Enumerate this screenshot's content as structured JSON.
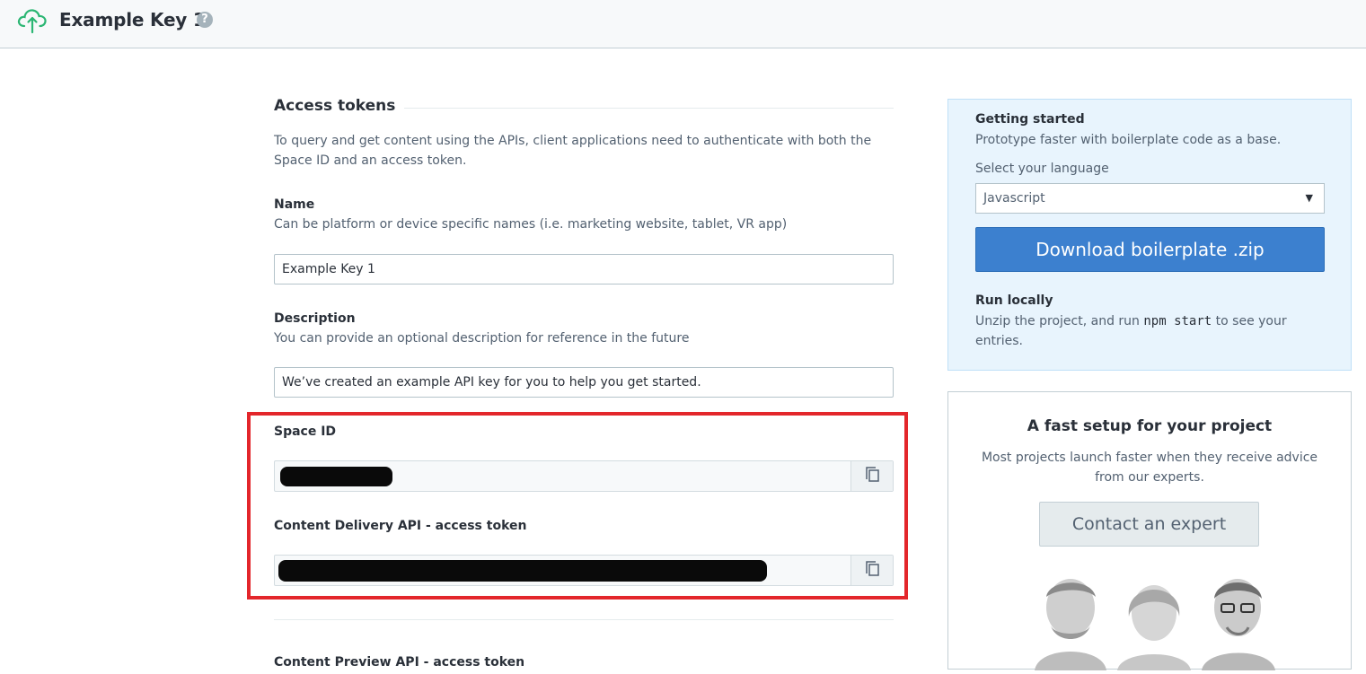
{
  "header": {
    "title": "Example Key 1",
    "help": "?"
  },
  "access_tokens": {
    "heading": "Access tokens",
    "intro": "To query and get content using the APIs, client applications need to authenticate with both the Space ID and an access token.",
    "name_label": "Name",
    "name_hint": "Can be platform or device specific names (i.e. marketing website, tablet, VR app)",
    "name_value": "Example Key 1",
    "description_label": "Description",
    "description_hint": "You can provide an optional description for reference in the future",
    "description_value": "We’ve created an example API key for you to help you get started.",
    "space_id_label": "Space ID",
    "cda_label": "Content Delivery API - access token",
    "cpa_label": "Content Preview API - access token"
  },
  "getting_started": {
    "title": "Getting started",
    "subtitle": "Prototype faster with boilerplate code as a base.",
    "language_label": "Select your language",
    "language_value": "Javascript",
    "download_label": "Download boilerplate .zip",
    "run_title": "Run locally",
    "run_text_before": "Unzip the project, and run ",
    "run_command": "npm start",
    "run_text_after": " to see your entries."
  },
  "expert": {
    "title": "A fast setup for your project",
    "text": "Most projects launch faster when they receive advice from our experts.",
    "contact_label": "Contact an expert"
  },
  "colors": {
    "accent": "#3c80cf",
    "highlight": "#e3262b",
    "panel": "#e8f4fd",
    "logo": "#2bb673"
  }
}
